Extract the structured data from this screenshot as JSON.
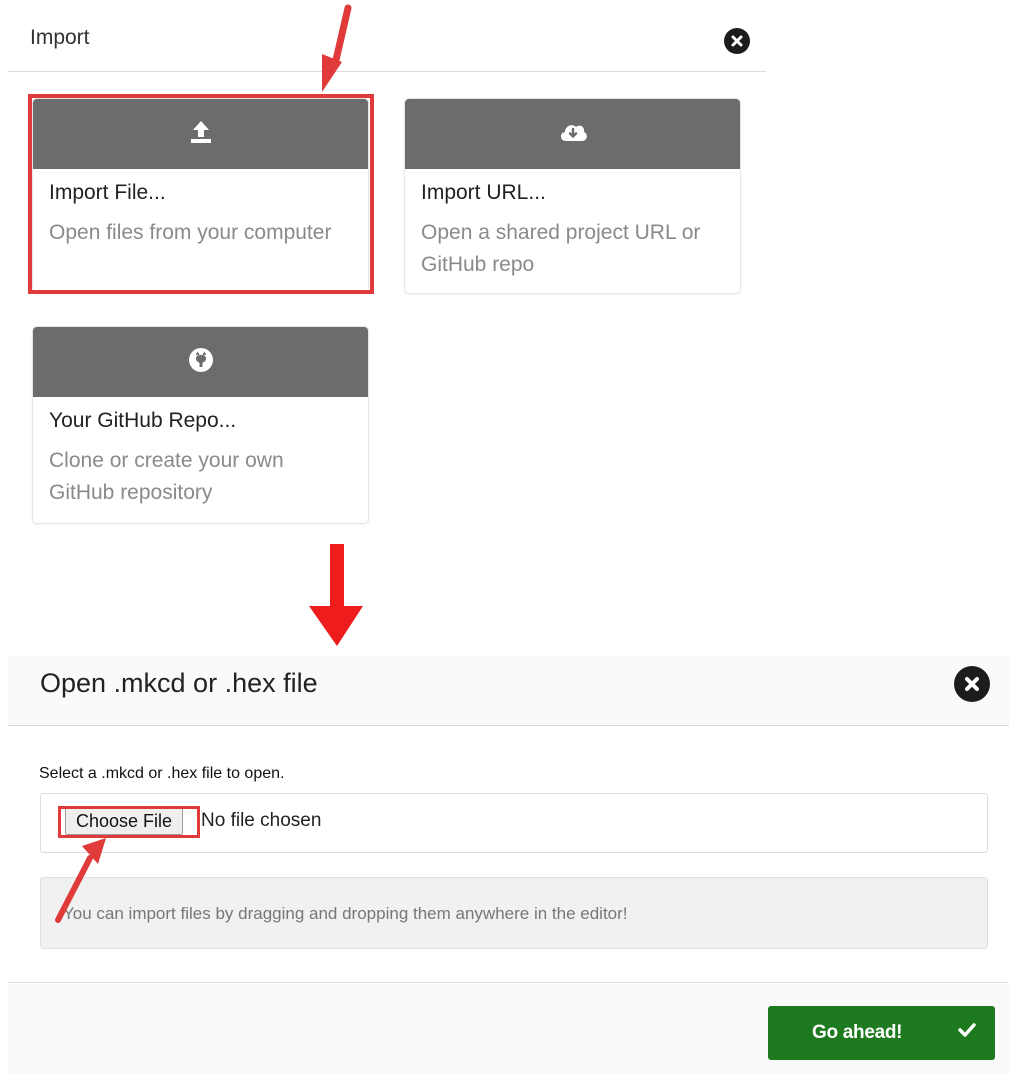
{
  "import_dialog": {
    "title": "Import",
    "close_icon": "close-circle-icon",
    "cards": [
      {
        "icon": "upload-icon",
        "title": "Import File...",
        "description": "Open files from your computer"
      },
      {
        "icon": "cloud-download-icon",
        "title": "Import URL...",
        "description": "Open a shared project URL or GitHub repo"
      },
      {
        "icon": "github-icon",
        "title": "Your GitHub Repo...",
        "description": "Clone or create your own GitHub repository"
      }
    ]
  },
  "open_dialog": {
    "title": "Open .mkcd or .hex file",
    "close_icon": "close-circle-icon",
    "select_label": "Select a .mkcd or .hex file to open.",
    "choose_file_label": "Choose File",
    "no_file_text": "No file chosen",
    "info_text": "You can import files by dragging and dropping them anywhere in the editor!",
    "go_button_label": "Go ahead!",
    "go_button_icon": "checkmark-icon"
  },
  "colors": {
    "card_header": "#6c6c6c",
    "annotation_red": "#e03a3a",
    "go_button": "#1e7a1e"
  }
}
